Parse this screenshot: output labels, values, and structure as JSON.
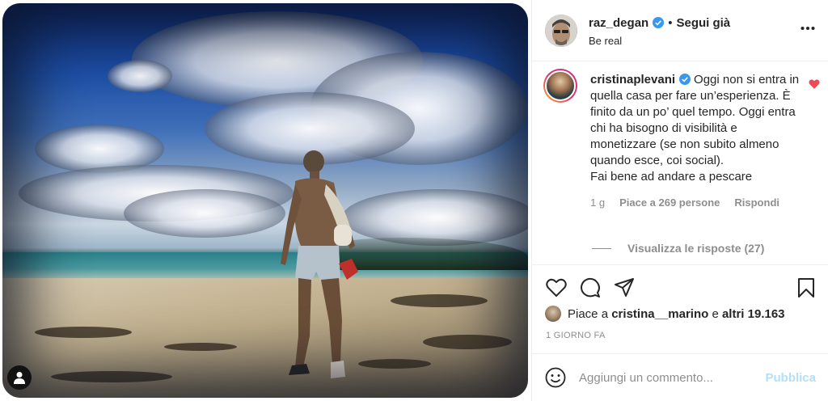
{
  "post": {
    "user_tag_icon": "user-icon"
  },
  "header": {
    "username": "raz_degan",
    "separator": "•",
    "follow_label": "Segui già",
    "subtitle": "Be real",
    "more_icon": "more-horizontal-icon"
  },
  "comment": {
    "username": "cristinaplevani",
    "text": "Oggi non si entra in quella casa per fare un’esperienza. È finito da un po’ quel tempo. Oggi entra chi ha bisogno di visibilità e monetizzare (se non subito almeno quando esce, coi social).\nFai bene ad andare a pescare",
    "time": "1 g",
    "likes": "Piace a 269 persone",
    "reply_label": "Rispondi",
    "view_replies": "Visualizza le risposte (27)",
    "liked_color": "#ed4956"
  },
  "actions": {
    "like_icon": "heart-icon",
    "comment_icon": "comment-icon",
    "share_icon": "send-icon",
    "save_icon": "bookmark-icon"
  },
  "likes": {
    "prefix": "Piace a",
    "user": "cristina__marino",
    "middle": "e",
    "others": "altri 19.163"
  },
  "date": "1 GIORNO FA",
  "add_comment": {
    "placeholder": "Aggiungi un commento...",
    "publish_label": "Pubblica",
    "emoji_icon": "smiley-icon",
    "publish_color": "#b2dffc"
  },
  "colors": {
    "verified": "#3897f0",
    "text": "#262626",
    "muted": "#8e8e8e",
    "border": "#efefef"
  }
}
